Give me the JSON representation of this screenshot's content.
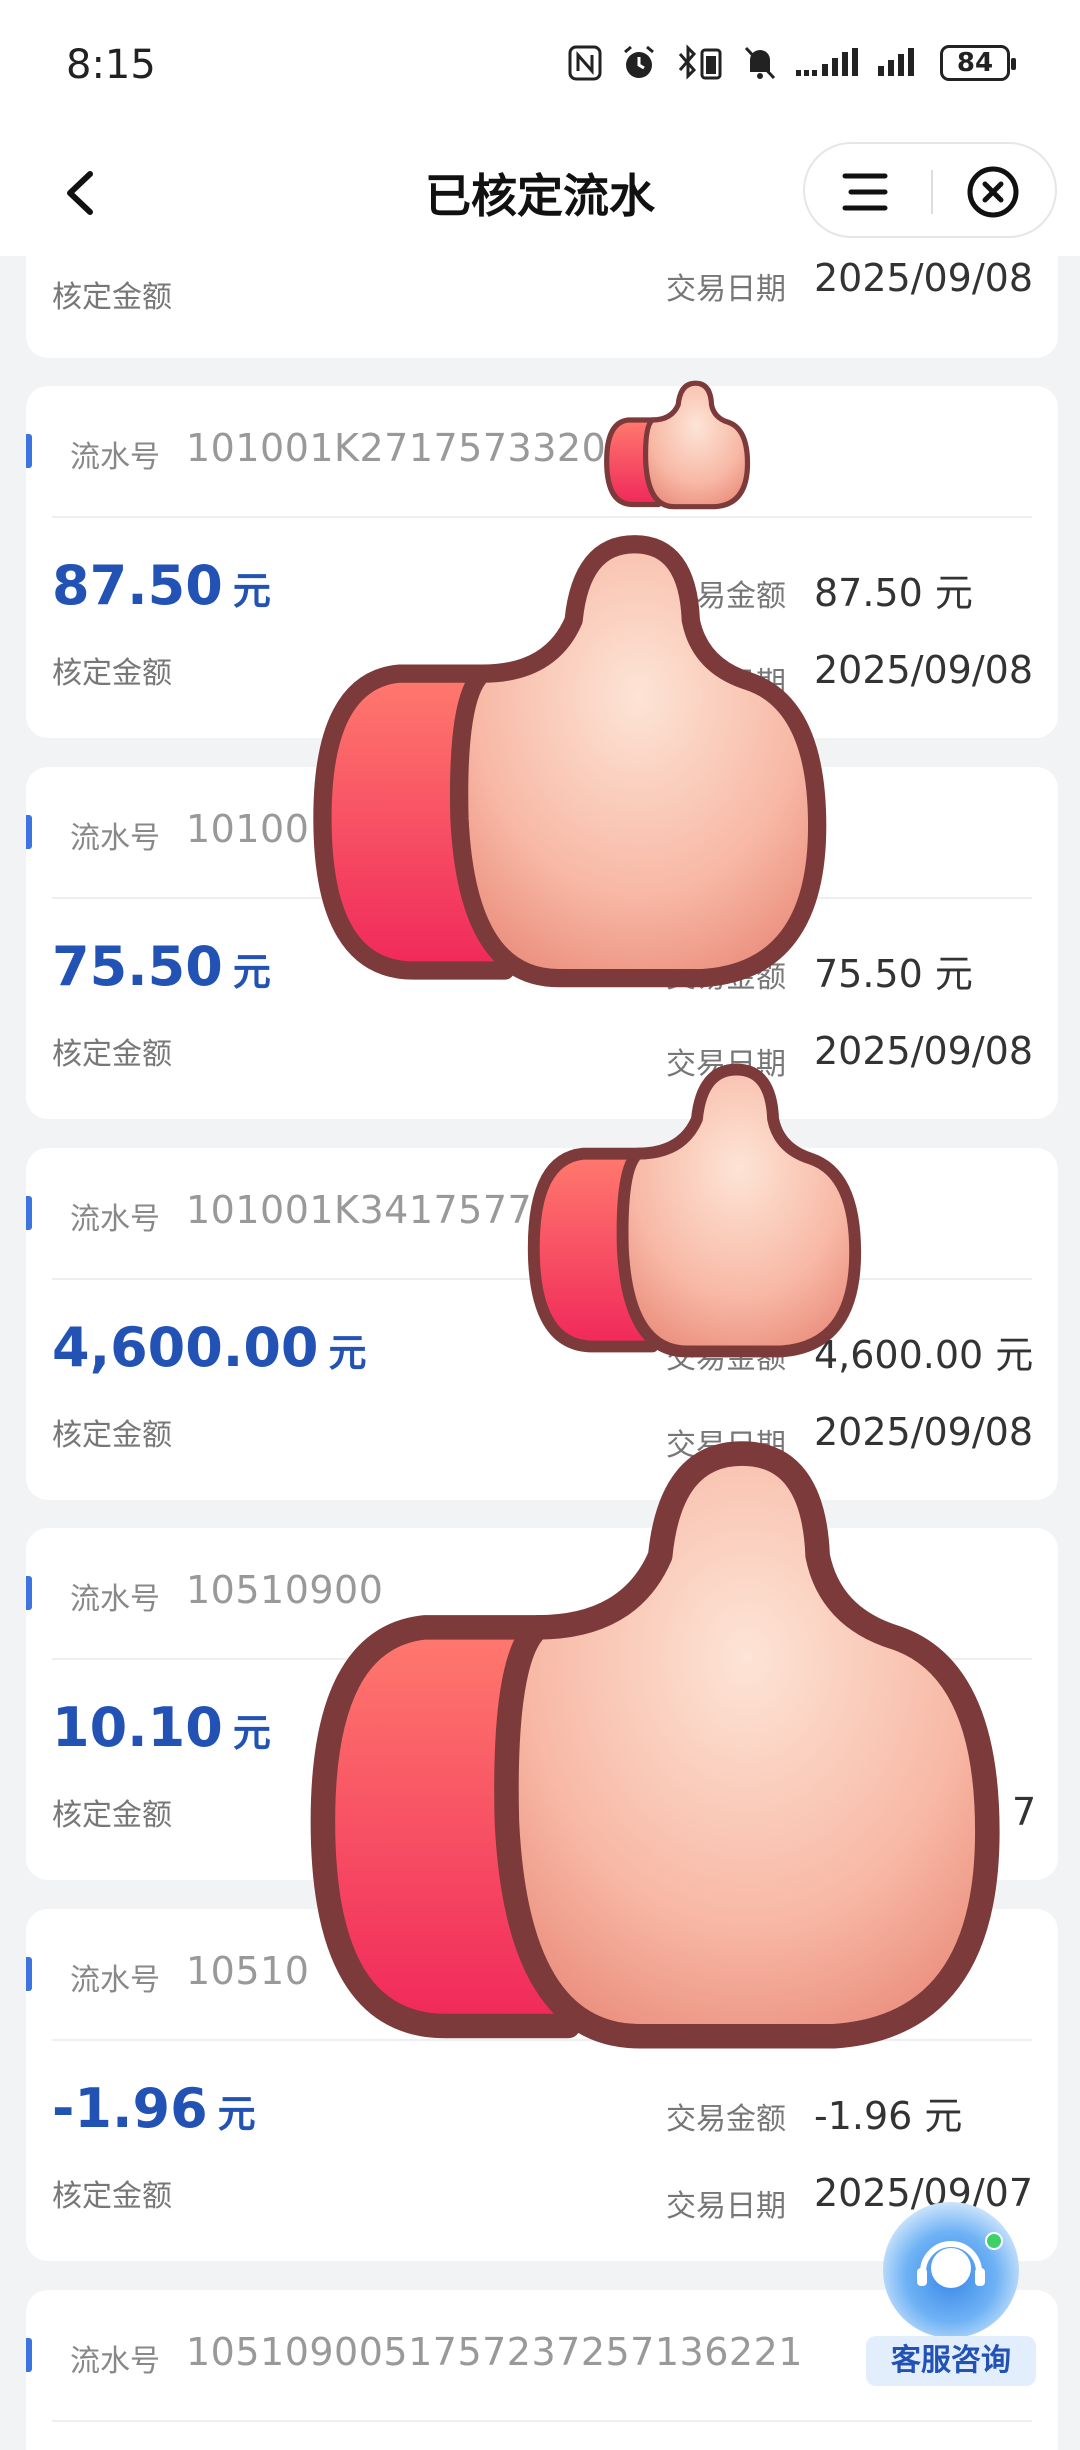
{
  "status_bar": {
    "time": "8:15",
    "battery": "84"
  },
  "header": {
    "title": "已核定流水"
  },
  "labels": {
    "serial": "流水号",
    "approved_amount": "核定金额",
    "transaction_amount": "交易金额",
    "transaction_date": "交易日期",
    "currency_unit": "元"
  },
  "partial_card": {
    "date": "2025/09/08"
  },
  "records": [
    {
      "serial": "101001K271757332031",
      "amount": "87.50",
      "tx_amount": "87.50 元",
      "date": "2025/09/08"
    },
    {
      "serial": "10100",
      "amount": "75.50",
      "tx_amount": "75.50 元",
      "date": "2025/09/08"
    },
    {
      "serial": "101001K34175773",
      "amount": "4,600.00",
      "tx_amount": "4,600.00 元",
      "date": "2025/09/08"
    },
    {
      "serial": "10510900",
      "amount": "10.10",
      "tx_amount": "",
      "date": "7"
    },
    {
      "serial": "10510",
      "amount": "-1.96",
      "tx_amount": "-1.96 元",
      "date": "2025/09/07"
    },
    {
      "serial": "105109005175723725713622​1",
      "amount": "",
      "tx_amount": "",
      "date": ""
    }
  ],
  "customer_service": {
    "label": "客服咨询"
  },
  "colors": {
    "accent": "#2352b5",
    "bar": "#3d74e0"
  }
}
